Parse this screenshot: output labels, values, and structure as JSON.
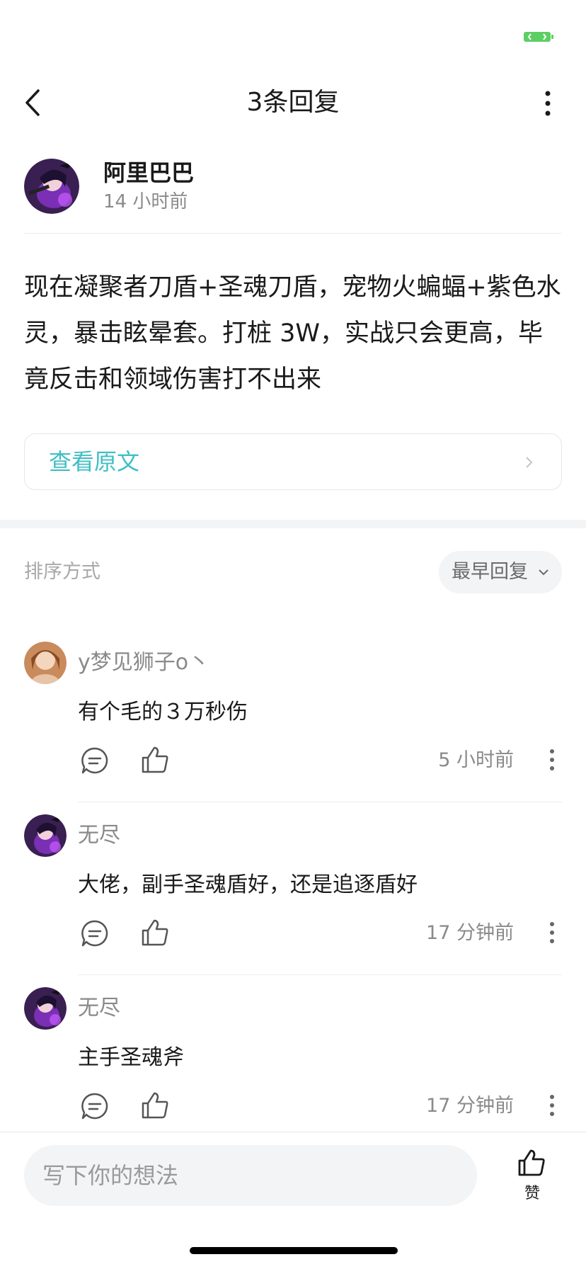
{
  "status": {
    "icon": "battery-icon",
    "color": "#5ccf63"
  },
  "nav": {
    "title": "3条回复",
    "back_icon": "back-arrow-icon",
    "more_icon": "more-vertical-icon"
  },
  "author": {
    "name": "阿里巴巴",
    "time": "14 小时前",
    "avatar": "anime-avatar"
  },
  "post": {
    "text": "现在凝聚者刀盾+圣魂刀盾，宠物火蝙蝠+紫色水灵，暴击眩晕套。打桩 3W，实战只会更高，毕竟反击和领域伤害打不出来",
    "view_original": "查看原文"
  },
  "sort": {
    "label": "排序方式",
    "value": "最早回复"
  },
  "comments": [
    {
      "name": "y梦见狮子o丶",
      "text": "有个毛的３万秒伤",
      "time": "5 小时前"
    },
    {
      "name": "无尽",
      "text": "大佬，副手圣魂盾好，还是追逐盾好",
      "time": "17 分钟前"
    },
    {
      "name": "无尽",
      "text": "主手圣魂斧",
      "time": "17 分钟前"
    }
  ],
  "bottom": {
    "placeholder": "写下你的想法",
    "like_label": "赞"
  },
  "colors": {
    "accent": "#3fbfc4",
    "muted": "#8a8a8a"
  }
}
